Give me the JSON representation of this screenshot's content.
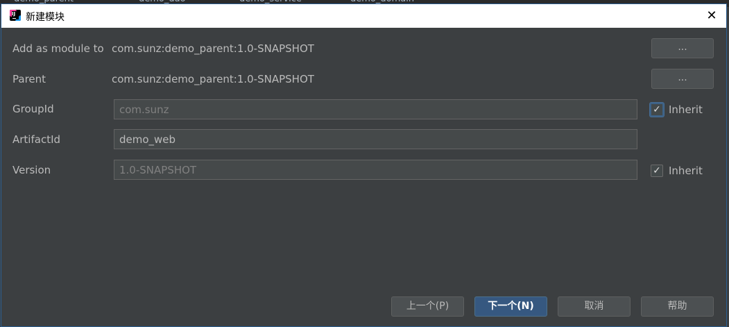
{
  "background_tabs": [
    "demo_parent",
    "demo_dao",
    "demo_service",
    "demo_domain"
  ],
  "window": {
    "title": "新建模块",
    "close_glyph": "✕",
    "app_icon": "intellij-idea-icon"
  },
  "form": {
    "add_as_module_to": {
      "label": "Add as module to",
      "value": "com.sunz:demo_parent:1.0-SNAPSHOT",
      "button_label": "..."
    },
    "parent": {
      "label": "Parent",
      "value": "com.sunz:demo_parent:1.0-SNAPSHOT",
      "button_label": "..."
    },
    "group_id": {
      "label": "GroupId",
      "value": "com.sunz",
      "enabled": false,
      "inherit_label": "Inherit",
      "inherit_checked": true
    },
    "artifact_id": {
      "label": "ArtifactId",
      "value": "demo_web",
      "enabled": true
    },
    "version": {
      "label": "Version",
      "value": "1.0-SNAPSHOT",
      "enabled": false,
      "inherit_label": "Inherit",
      "inherit_checked": true
    }
  },
  "footer": {
    "previous_label": "上一个(P)",
    "next_label": "下一个(N)",
    "cancel_label": "取消",
    "help_label": "帮助"
  },
  "colors": {
    "background": "#3c3f41",
    "primary_button": "#365880",
    "text": "#bbbbbb",
    "title_bar": "#ffffff"
  }
}
